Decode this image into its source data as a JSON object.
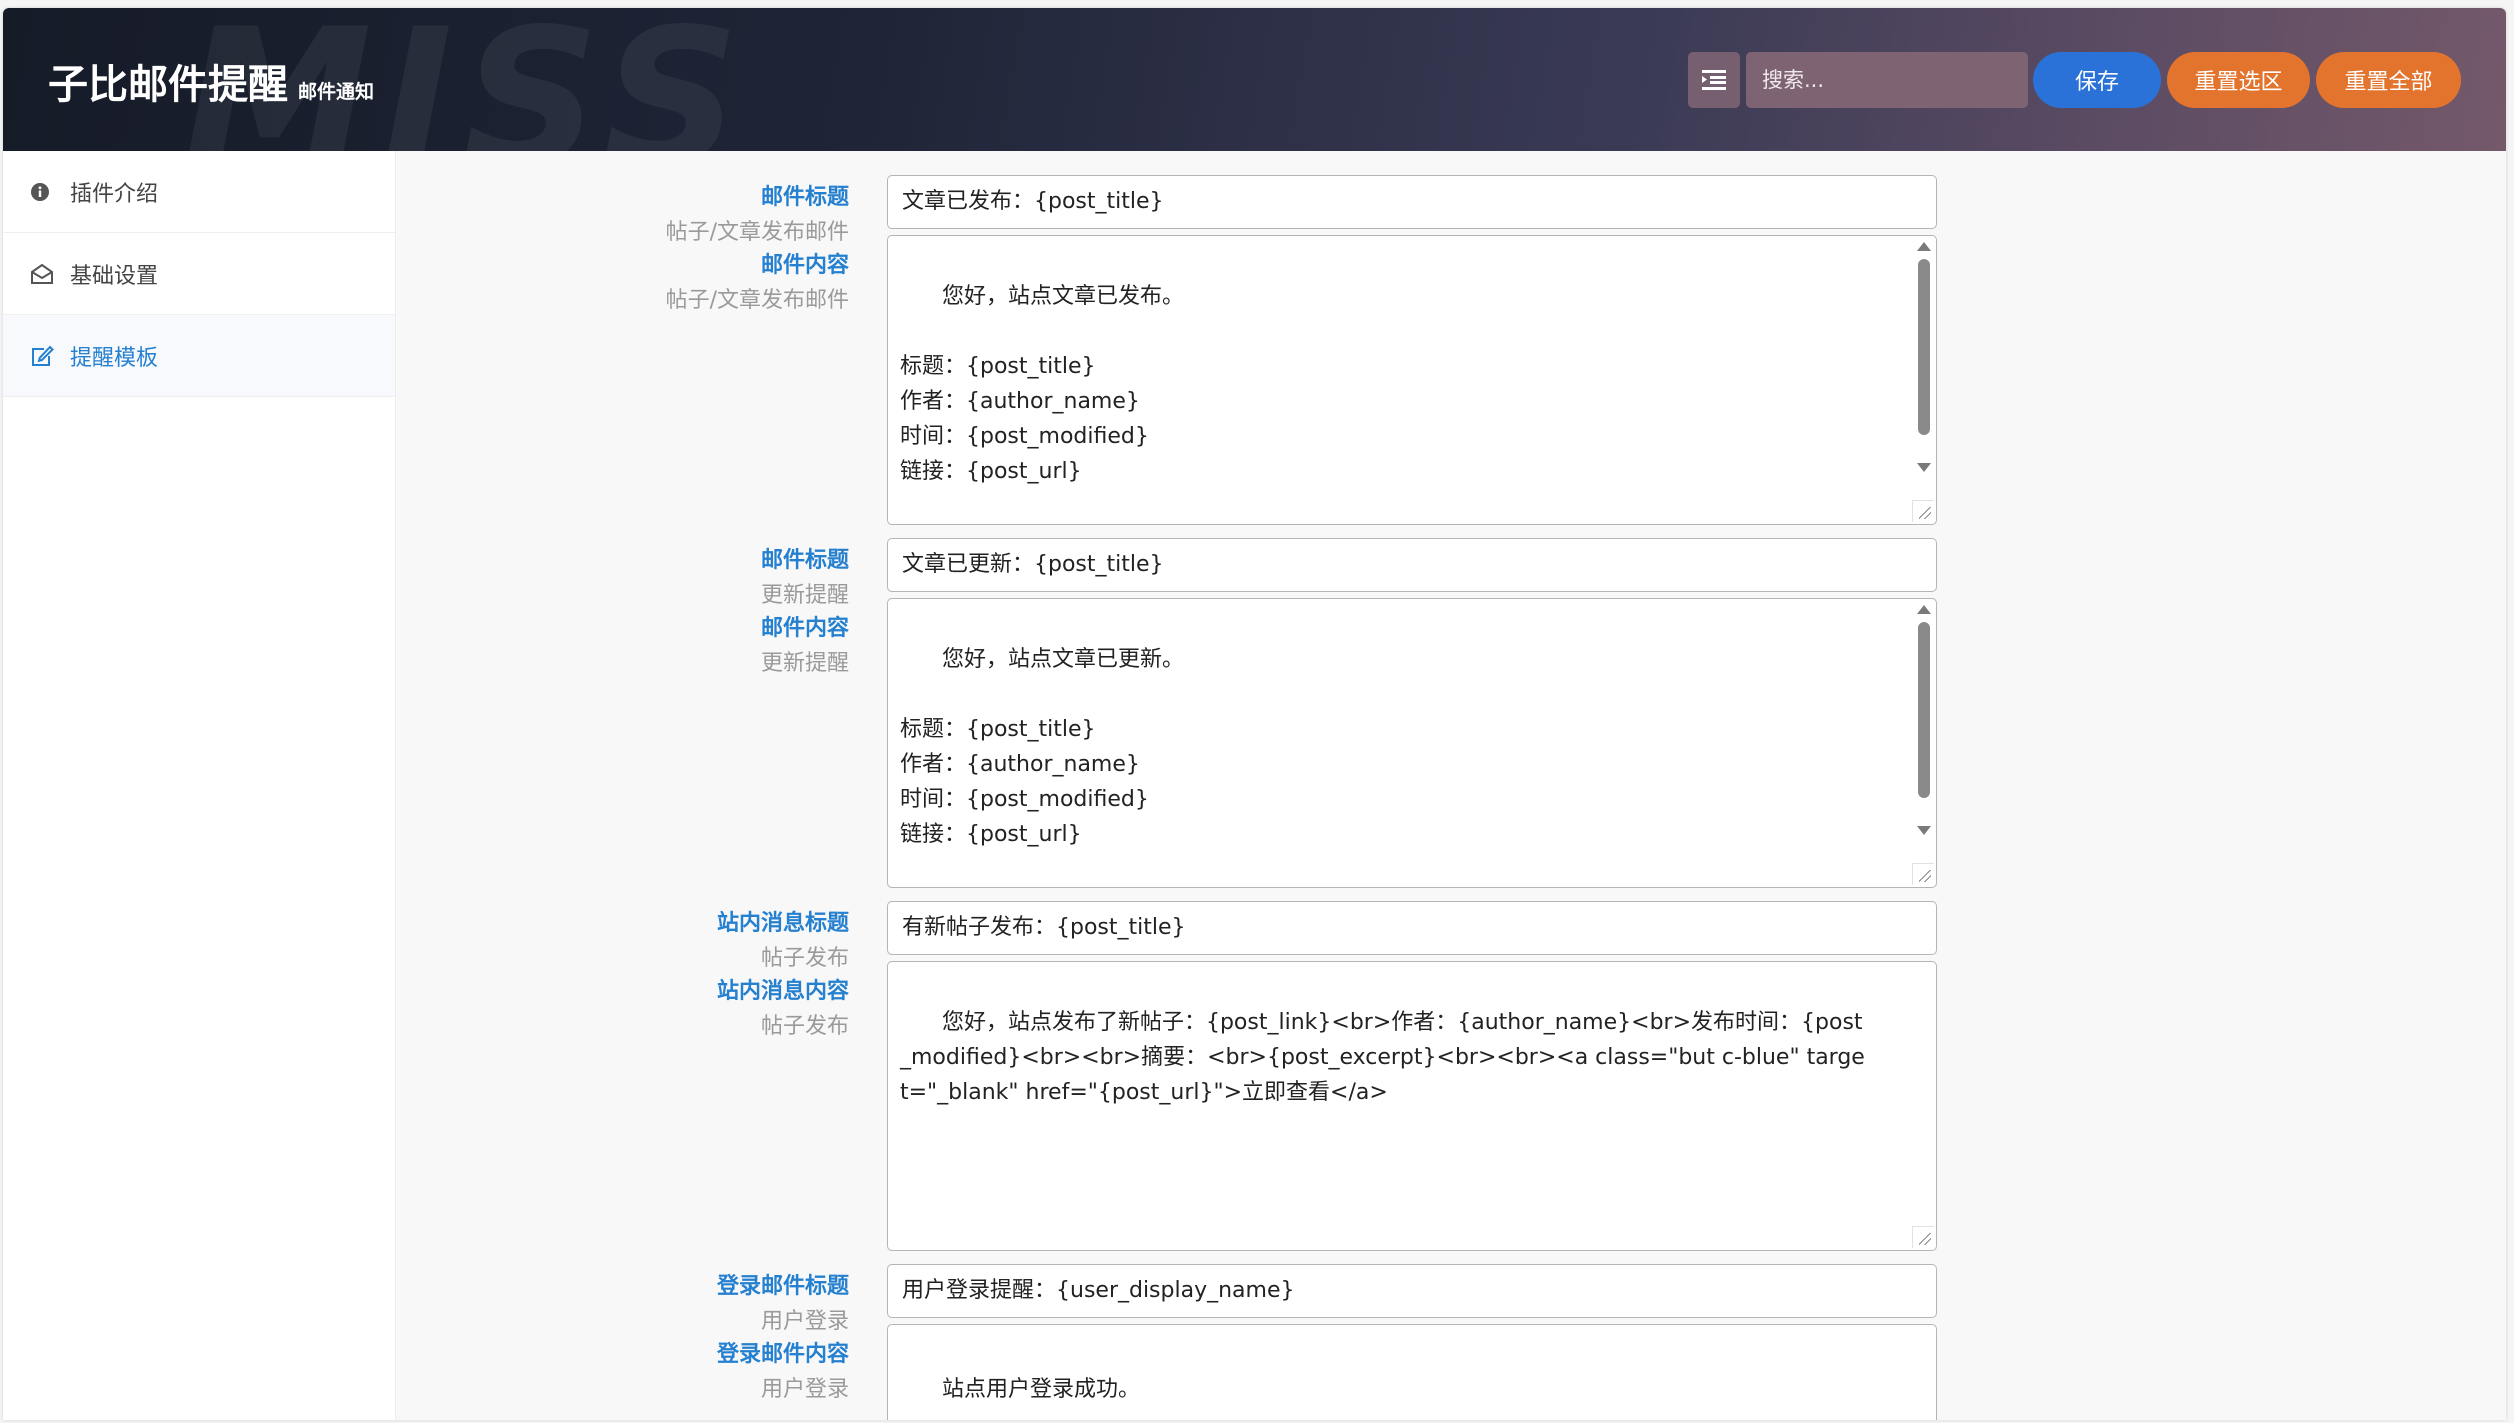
{
  "header": {
    "watermark": "MISS",
    "title": "子比邮件提醒",
    "subtitle": "邮件通知",
    "search_placeholder": "搜索...",
    "save_label": "保存",
    "reset_section_label": "重置选区",
    "reset_all_label": "重置全部"
  },
  "sidebar": {
    "items": [
      {
        "label": "插件介绍",
        "icon": "info-circle-icon"
      },
      {
        "label": "基础设置",
        "icon": "envelope-open-icon"
      },
      {
        "label": "提醒模板",
        "icon": "edit-icon",
        "active": true
      }
    ]
  },
  "fields": [
    {
      "title_label": "邮件标题",
      "title_sub": "帖子/文章发布邮件",
      "title_value": "文章已发布：{post_title}",
      "content_label": "邮件内容",
      "content_sub": "帖子/文章发布邮件",
      "content_value": "您好，站点文章已发布。\n\n标题：{post_title}\n作者：{author_name}\n时间：{post_modified}\n链接：{post_url}\n\n摘要："
    },
    {
      "title_label": "邮件标题",
      "title_sub": "更新提醒",
      "title_value": "文章已更新：{post_title}",
      "content_label": "邮件内容",
      "content_sub": "更新提醒",
      "content_value": "您好，站点文章已更新。\n\n标题：{post_title}\n作者：{author_name}\n时间：{post_modified}\n链接：{post_url}\n\n摘要："
    },
    {
      "title_label": "站内消息标题",
      "title_sub": "帖子发布",
      "title_value": "有新帖子发布：{post_title}",
      "content_label": "站内消息内容",
      "content_sub": "帖子发布",
      "content_value": "您好，站点发布了新帖子：{post_link}<br>作者：{author_name}<br>发布时间：{post_modified}<br><br>摘要：<br>{post_excerpt}<br><br><a class=\"but c-blue\" target=\"_blank\" href=\"{post_url}\">立即查看</a>"
    },
    {
      "title_label": "登录邮件标题",
      "title_sub": "用户登录",
      "title_value": "用户登录提醒：{user_display_name}",
      "content_label": "登录邮件内容",
      "content_sub": "用户登录",
      "content_value": "站点用户登录成功。\n\n用户：{user_display_name}（{user_login}）"
    }
  ],
  "colors": {
    "accent": "#2680d0",
    "save": "#2b72d8",
    "reset": "#e2742e"
  }
}
